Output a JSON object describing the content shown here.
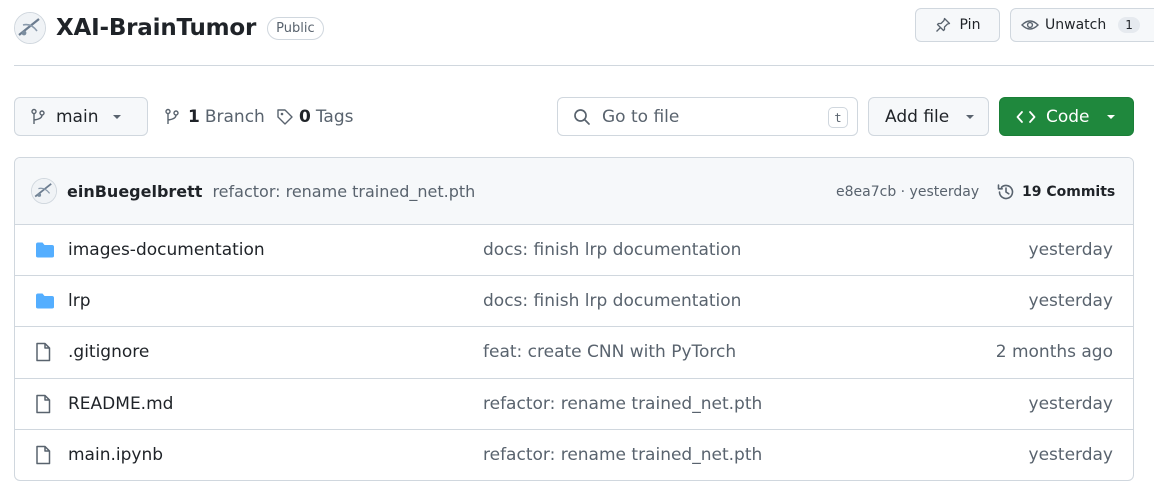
{
  "repo": {
    "name": "XAI-BrainTumor",
    "visibility": "Public",
    "pin_label": "Pin",
    "watch_label": "Unwatch",
    "watch_count": "1"
  },
  "toolbar": {
    "branch": "main",
    "branch_count": "1",
    "branch_label": "Branch",
    "tag_count": "0",
    "tag_label": "Tags",
    "search_placeholder": "Go to file",
    "search_shortcut": "t",
    "add_file_label": "Add file",
    "code_label": "Code"
  },
  "latest_commit": {
    "author": "einBuegelbrett",
    "message": "refactor: rename trained_net.pth",
    "hash_time": "e8ea7cb · yesterday",
    "commits_label": "19 Commits"
  },
  "files": [
    {
      "type": "folder",
      "icon": "folder-icon",
      "name": "images-documentation",
      "message": "docs: finish lrp documentation",
      "date": "yesterday"
    },
    {
      "type": "folder",
      "icon": "folder-icon",
      "name": "lrp",
      "message": "docs: finish lrp documentation",
      "date": "yesterday"
    },
    {
      "type": "file",
      "icon": "file-icon",
      "name": ".gitignore",
      "message": "feat: create CNN with PyTorch",
      "date": "2 months ago"
    },
    {
      "type": "file",
      "icon": "file-icon",
      "name": "README.md",
      "message": "refactor: rename trained_net.pth",
      "date": "yesterday"
    },
    {
      "type": "file",
      "icon": "file-icon",
      "name": "main.ipynb",
      "message": "refactor: rename trained_net.pth",
      "date": "yesterday"
    }
  ],
  "colors": {
    "accent_green": "#1f883d",
    "folder_blue": "#54aeff",
    "muted_text": "#59636e",
    "border": "#d0d7de"
  }
}
